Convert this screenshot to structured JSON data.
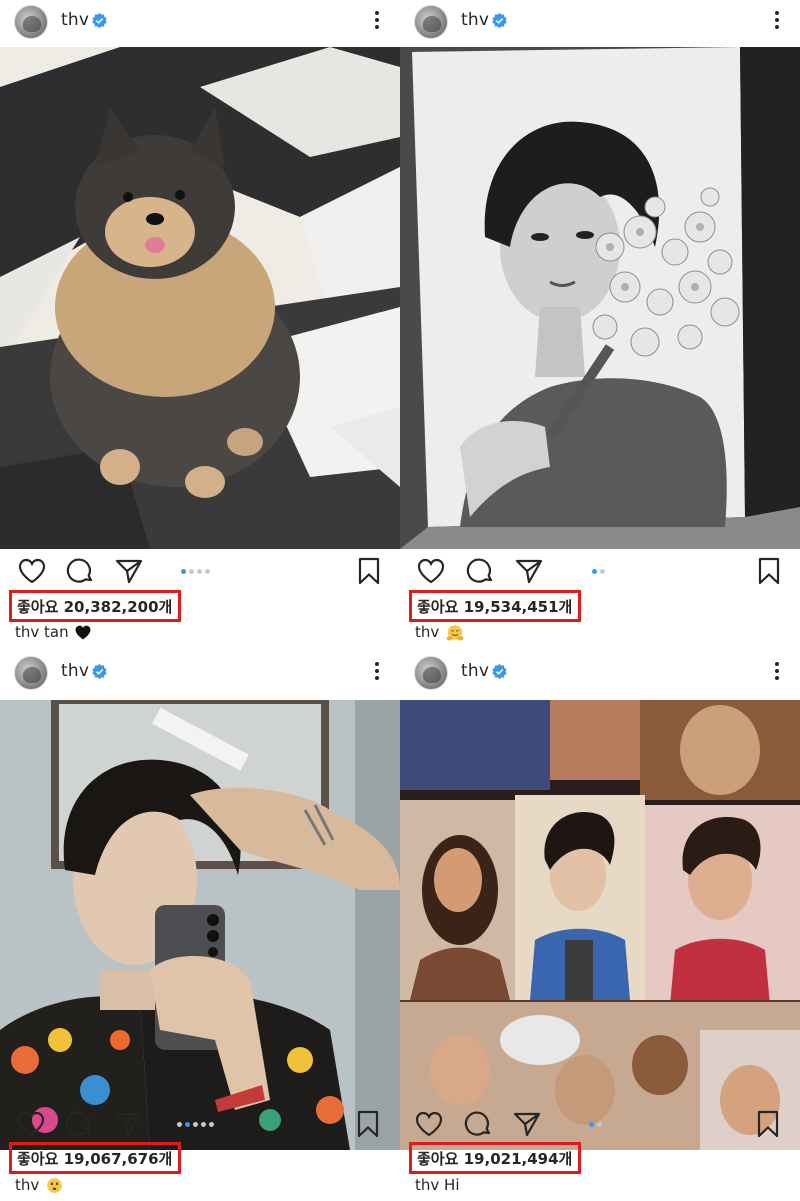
{
  "posts": [
    {
      "username": "thv",
      "likes": "좋아요 20,382,200개",
      "caption_user": "thv",
      "caption_text": "tan",
      "caption_emoji": "black-heart",
      "carousel": {
        "count": 4,
        "active": 1
      }
    },
    {
      "username": "thv",
      "likes": "좋아요 19,534,451개",
      "caption_user": "thv",
      "caption_text": "",
      "caption_emoji": "hugging-face",
      "carousel": {
        "count": 2,
        "active": 1
      }
    },
    {
      "username": "thv",
      "likes": "좋아요 19,067,676개",
      "caption_user": "thv",
      "caption_text": "",
      "caption_emoji": "hushed-face",
      "carousel": {
        "count": 5,
        "active": 2
      }
    },
    {
      "username": "thv",
      "likes": "좋아요 19,021,494개",
      "caption_user": "thv",
      "caption_text": "Hi",
      "caption_emoji": "",
      "carousel": {
        "count": 2,
        "active": 1
      }
    }
  ],
  "colors": {
    "verified": "#3897f0",
    "highlight_box": "#e01b1b",
    "active_dot": "#3897f0"
  }
}
